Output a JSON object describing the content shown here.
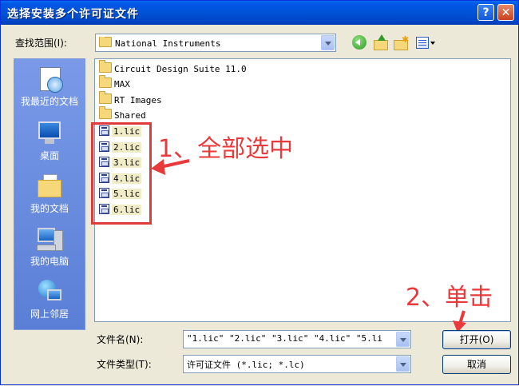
{
  "window": {
    "title": "选择安装多个许可证文件",
    "help_glyph": "?",
    "close_glyph": "✕"
  },
  "lookin": {
    "label": "查找范围(I):",
    "value": "National Instruments"
  },
  "toolbar": {
    "back": "back-icon",
    "up": "up-folder-icon",
    "new_folder": "new-folder-icon",
    "views": "views-menu-icon"
  },
  "places": [
    {
      "label": "我最近的文档",
      "icon": "recent-documents-icon"
    },
    {
      "label": "桌面",
      "icon": "desktop-icon"
    },
    {
      "label": "我的文档",
      "icon": "my-documents-icon"
    },
    {
      "label": "我的电脑",
      "icon": "my-computer-icon"
    },
    {
      "label": "网上邻居",
      "icon": "network-places-icon"
    }
  ],
  "files": {
    "folders": [
      "Circuit Design Suite 11.0",
      "MAX",
      "RT Images",
      "Shared"
    ],
    "lic": [
      "1.lic",
      "2.lic",
      "3.lic",
      "4.lic",
      "5.lic",
      "6.lic"
    ]
  },
  "annotations": {
    "step1": "1、全部选中",
    "step2": "2、单击",
    "color": "#e83a3a"
  },
  "filename": {
    "label": "文件名(N):",
    "value": "\"1.lic\" \"2.lic\" \"3.lic\" \"4.lic\" \"5.li"
  },
  "filetype": {
    "label": "文件类型(T):",
    "value": "许可证文件 (*.lic; *.lc)"
  },
  "buttons": {
    "open": "打开(O)",
    "cancel": "取消"
  }
}
